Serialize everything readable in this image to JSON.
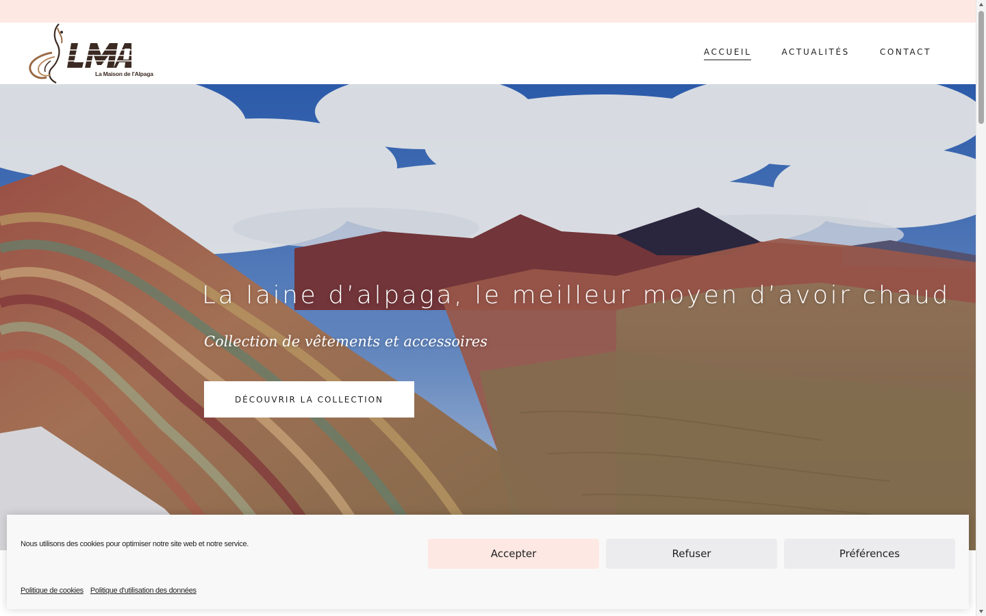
{
  "brand": {
    "logo_letters": "LMA",
    "name": "La Maison de l'Alpaga",
    "accent_color": "#fde8e3",
    "logo_color": "#3b2a22"
  },
  "nav": {
    "items": [
      {
        "label": "ACCUEIL",
        "active": true
      },
      {
        "label": "ACTUALITÉS",
        "active": false
      },
      {
        "label": "CONTACT",
        "active": false
      }
    ]
  },
  "hero": {
    "title": "La laine d’alpaga, le meilleur moyen d’avoir chaud",
    "subtitle": "Collection de vêtements et accessoires",
    "cta_label": "DÉCOUVRIR LA COLLECTION",
    "image": "rainbow-mountain-landscape"
  },
  "cookie_banner": {
    "message": "Nous utilisons des cookies pour optimiser notre site web et notre service.",
    "accept_label": "Accepter",
    "refuse_label": "Refuser",
    "preferences_label": "Préférences",
    "links": [
      {
        "label": "Politique de cookies"
      },
      {
        "label": "Politique d'utilisation des données"
      }
    ]
  },
  "icons": {
    "scroll_up": "chevron-up-icon",
    "scroll_down": "chevron-down-icon"
  }
}
